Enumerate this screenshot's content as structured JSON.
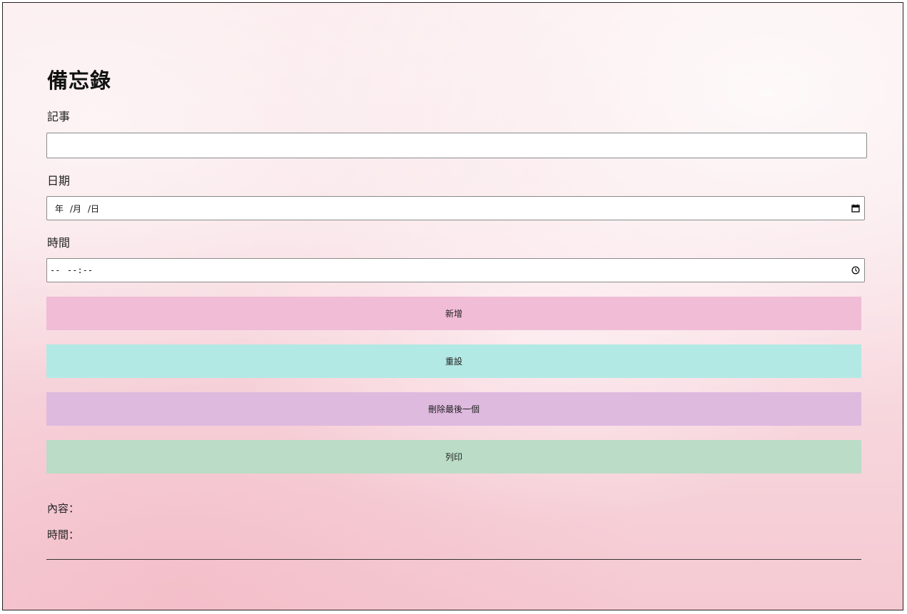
{
  "page": {
    "title": "備忘錄"
  },
  "form": {
    "note_label": "記事",
    "note_value": "",
    "date_label": "日期",
    "date_year": "年",
    "date_month": "/月",
    "date_day": "/日",
    "time_label": "時間",
    "time_period": "--",
    "time_clock": "--:--"
  },
  "buttons": {
    "add": {
      "label": "新增",
      "color": "#f0bcd6"
    },
    "reset": {
      "label": "重設",
      "color": "#b3e9e4"
    },
    "delete_last": {
      "label": "刪除最後一個",
      "color": "#dfbadf"
    },
    "print": {
      "label": "列印",
      "color": "#bbdcc6"
    }
  },
  "output": {
    "content_label": "內容：",
    "time_label": "時間："
  }
}
